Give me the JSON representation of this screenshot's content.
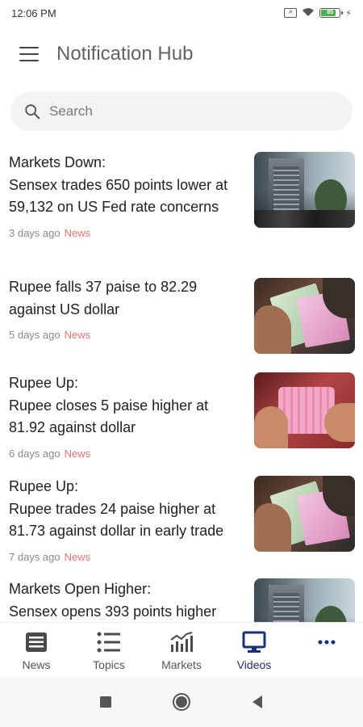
{
  "status_bar": {
    "time": "12:06 PM",
    "battery_level": "85"
  },
  "header": {
    "title": "Notification Hub"
  },
  "search": {
    "placeholder": "Search"
  },
  "feed": [
    {
      "headline": "Markets Down:\nSensex trades 650 points lower at 59,132 on US Fed rate concerns",
      "age": "3 days ago",
      "category": "News",
      "thumb": "market"
    },
    {
      "headline": "Rupee falls 37 paise to 82.29 against US dollar",
      "age": "5 days ago",
      "category": "News",
      "thumb": "cash"
    },
    {
      "headline": "Rupee Up:\nRupee closes 5 paise higher at 81.92 against dollar",
      "age": "6 days ago",
      "category": "News",
      "thumb": "pink"
    },
    {
      "headline": "Rupee Up:\nRupee trades 24 paise higher at 81.73 against dollar in early trade",
      "age": "7 days ago",
      "category": "News",
      "thumb": "cash"
    },
    {
      "headline": "Markets Open Higher:\nSensex opens 393 points higher",
      "age": "",
      "category": "",
      "thumb": "market"
    }
  ],
  "bottom_nav": [
    {
      "label": "News",
      "icon": "newspaper-icon"
    },
    {
      "label": "Topics",
      "icon": "list-icon"
    },
    {
      "label": "Markets",
      "icon": "chart-icon"
    },
    {
      "label": "Videos",
      "icon": "monitor-icon",
      "active": true
    },
    {
      "label": "",
      "icon": "more-icon"
    }
  ],
  "colors": {
    "accent": "#1a2e7a",
    "category": "#e57373"
  }
}
